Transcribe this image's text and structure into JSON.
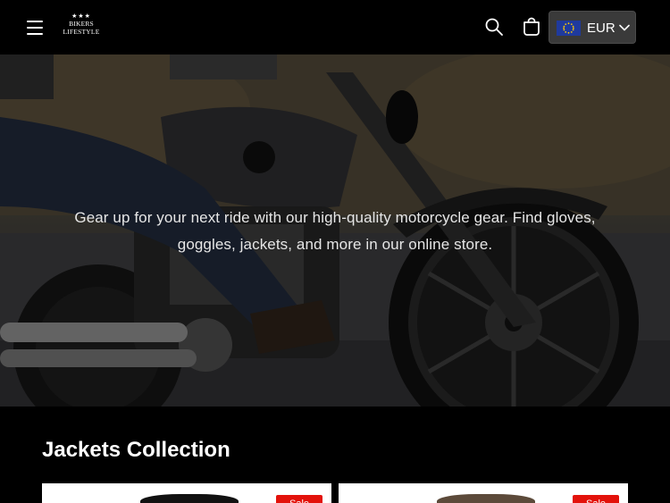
{
  "header": {
    "menu_icon": "hamburger-menu-icon",
    "logo": {
      "stars": "★★★",
      "line1": "BIKERS",
      "line2": "LIFESTYLE"
    },
    "search_icon": "search-icon",
    "cart_icon": "cart-icon",
    "currency": {
      "code": "EUR",
      "flag": "eu-flag-icon"
    }
  },
  "hero": {
    "text": "Gear up for your next ride with our high-quality motorcycle gear. Find gloves, goggles, jackets, and more in our online store."
  },
  "collection": {
    "title": "Jackets Collection",
    "products": [
      {
        "badge": "Sale"
      },
      {
        "badge": "Sale"
      }
    ]
  },
  "colors": {
    "background": "#000000",
    "sale_badge": "#e3120b",
    "currency_bg": "#3a3a3a",
    "eu_blue": "#1f3a9e"
  }
}
